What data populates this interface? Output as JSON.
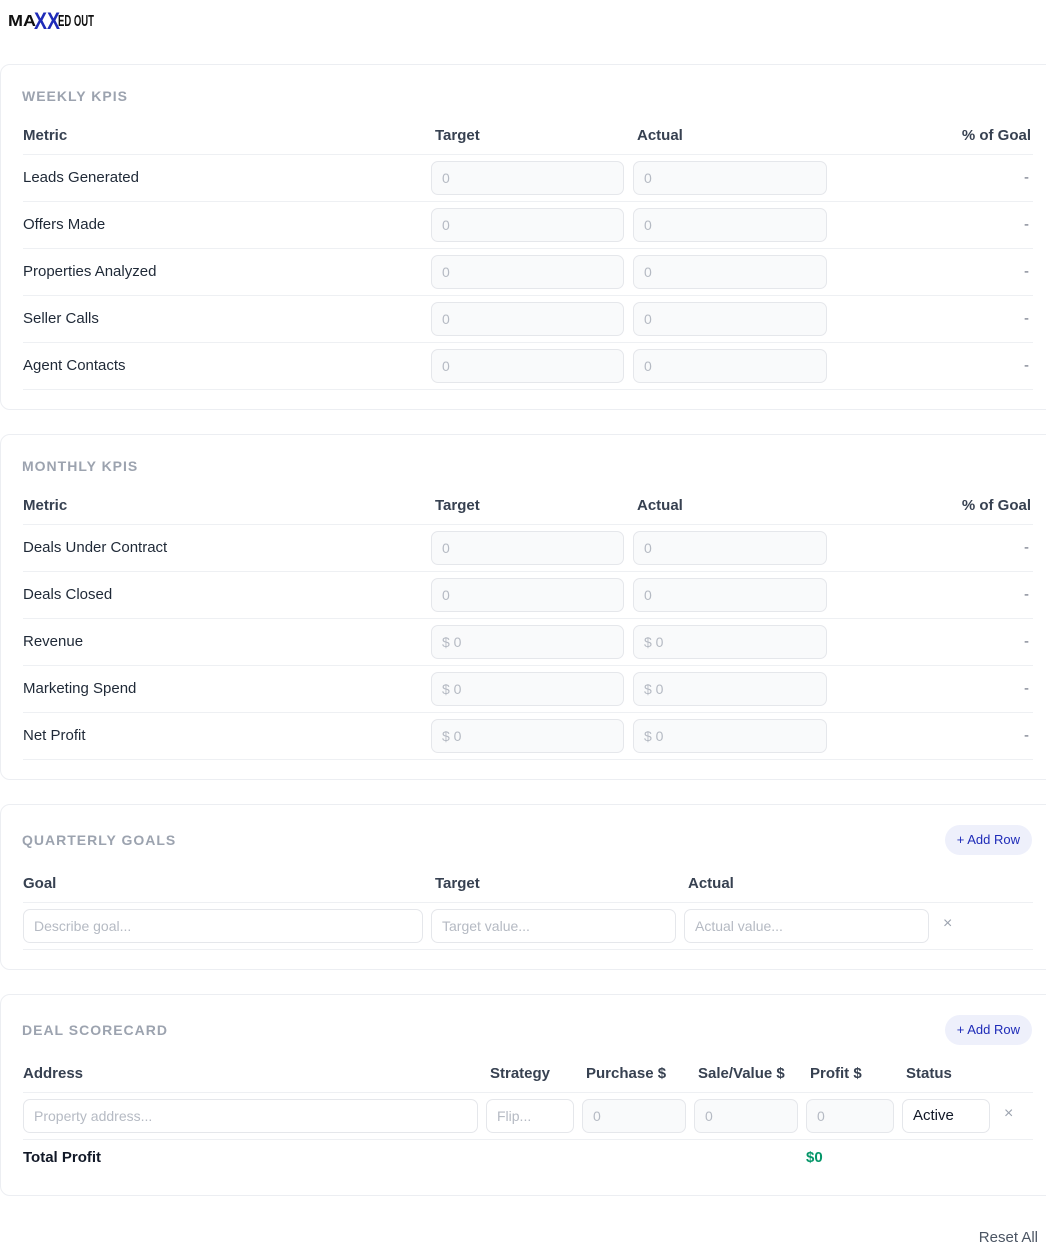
{
  "brand": {
    "logo_text": "MAXXED OUT"
  },
  "weekly": {
    "title": "WEEKLY KPIS",
    "headers": {
      "metric": "Metric",
      "target": "Target",
      "actual": "Actual",
      "pct": "% of Goal"
    },
    "rows": [
      {
        "label": "Leads Generated",
        "target_ph": "0",
        "actual_ph": "0",
        "pct": "-"
      },
      {
        "label": "Offers Made",
        "target_ph": "0",
        "actual_ph": "0",
        "pct": "-"
      },
      {
        "label": "Properties Analyzed",
        "target_ph": "0",
        "actual_ph": "0",
        "pct": "-"
      },
      {
        "label": "Seller Calls",
        "target_ph": "0",
        "actual_ph": "0",
        "pct": "-"
      },
      {
        "label": "Agent Contacts",
        "target_ph": "0",
        "actual_ph": "0",
        "pct": "-"
      }
    ]
  },
  "monthly": {
    "title": "MONTHLY KPIS",
    "headers": {
      "metric": "Metric",
      "target": "Target",
      "actual": "Actual",
      "pct": "% of Goal"
    },
    "rows": [
      {
        "label": "Deals Under Contract",
        "target_ph": "0",
        "actual_ph": "0",
        "pct": "-"
      },
      {
        "label": "Deals Closed",
        "target_ph": "0",
        "actual_ph": "0",
        "pct": "-"
      },
      {
        "label": "Revenue",
        "target_ph": "$ 0",
        "actual_ph": "$ 0",
        "pct": "-"
      },
      {
        "label": "Marketing Spend",
        "target_ph": "$ 0",
        "actual_ph": "$ 0",
        "pct": "-"
      },
      {
        "label": "Net Profit",
        "target_ph": "$ 0",
        "actual_ph": "$ 0",
        "pct": "-"
      }
    ]
  },
  "quarterly": {
    "title": "QUARTERLY GOALS",
    "add_label": "+ Add Row",
    "headers": {
      "goal": "Goal",
      "target": "Target",
      "actual": "Actual"
    },
    "row": {
      "goal_ph": "Describe goal...",
      "target_ph": "Target value...",
      "actual_ph": "Actual value...",
      "remove": "×"
    }
  },
  "deals": {
    "title": "DEAL SCORECARD",
    "add_label": "+ Add Row",
    "headers": {
      "address": "Address",
      "strategy": "Strategy",
      "purchase": "Purchase $",
      "sale": "Sale/Value $",
      "profit": "Profit $",
      "status": "Status"
    },
    "row": {
      "address_ph": "Property address...",
      "strategy_ph": "Flip...",
      "purchase_ph": "0",
      "sale_ph": "0",
      "profit_ph": "0",
      "status": "Active",
      "remove": "×"
    },
    "total_label": "Total Profit",
    "total_value": "$0"
  },
  "footer": {
    "reset_label": "Reset All"
  },
  "colors": {
    "accent": "#1e2bb8",
    "profit_green": "#059669",
    "muted": "#9ca3af"
  }
}
